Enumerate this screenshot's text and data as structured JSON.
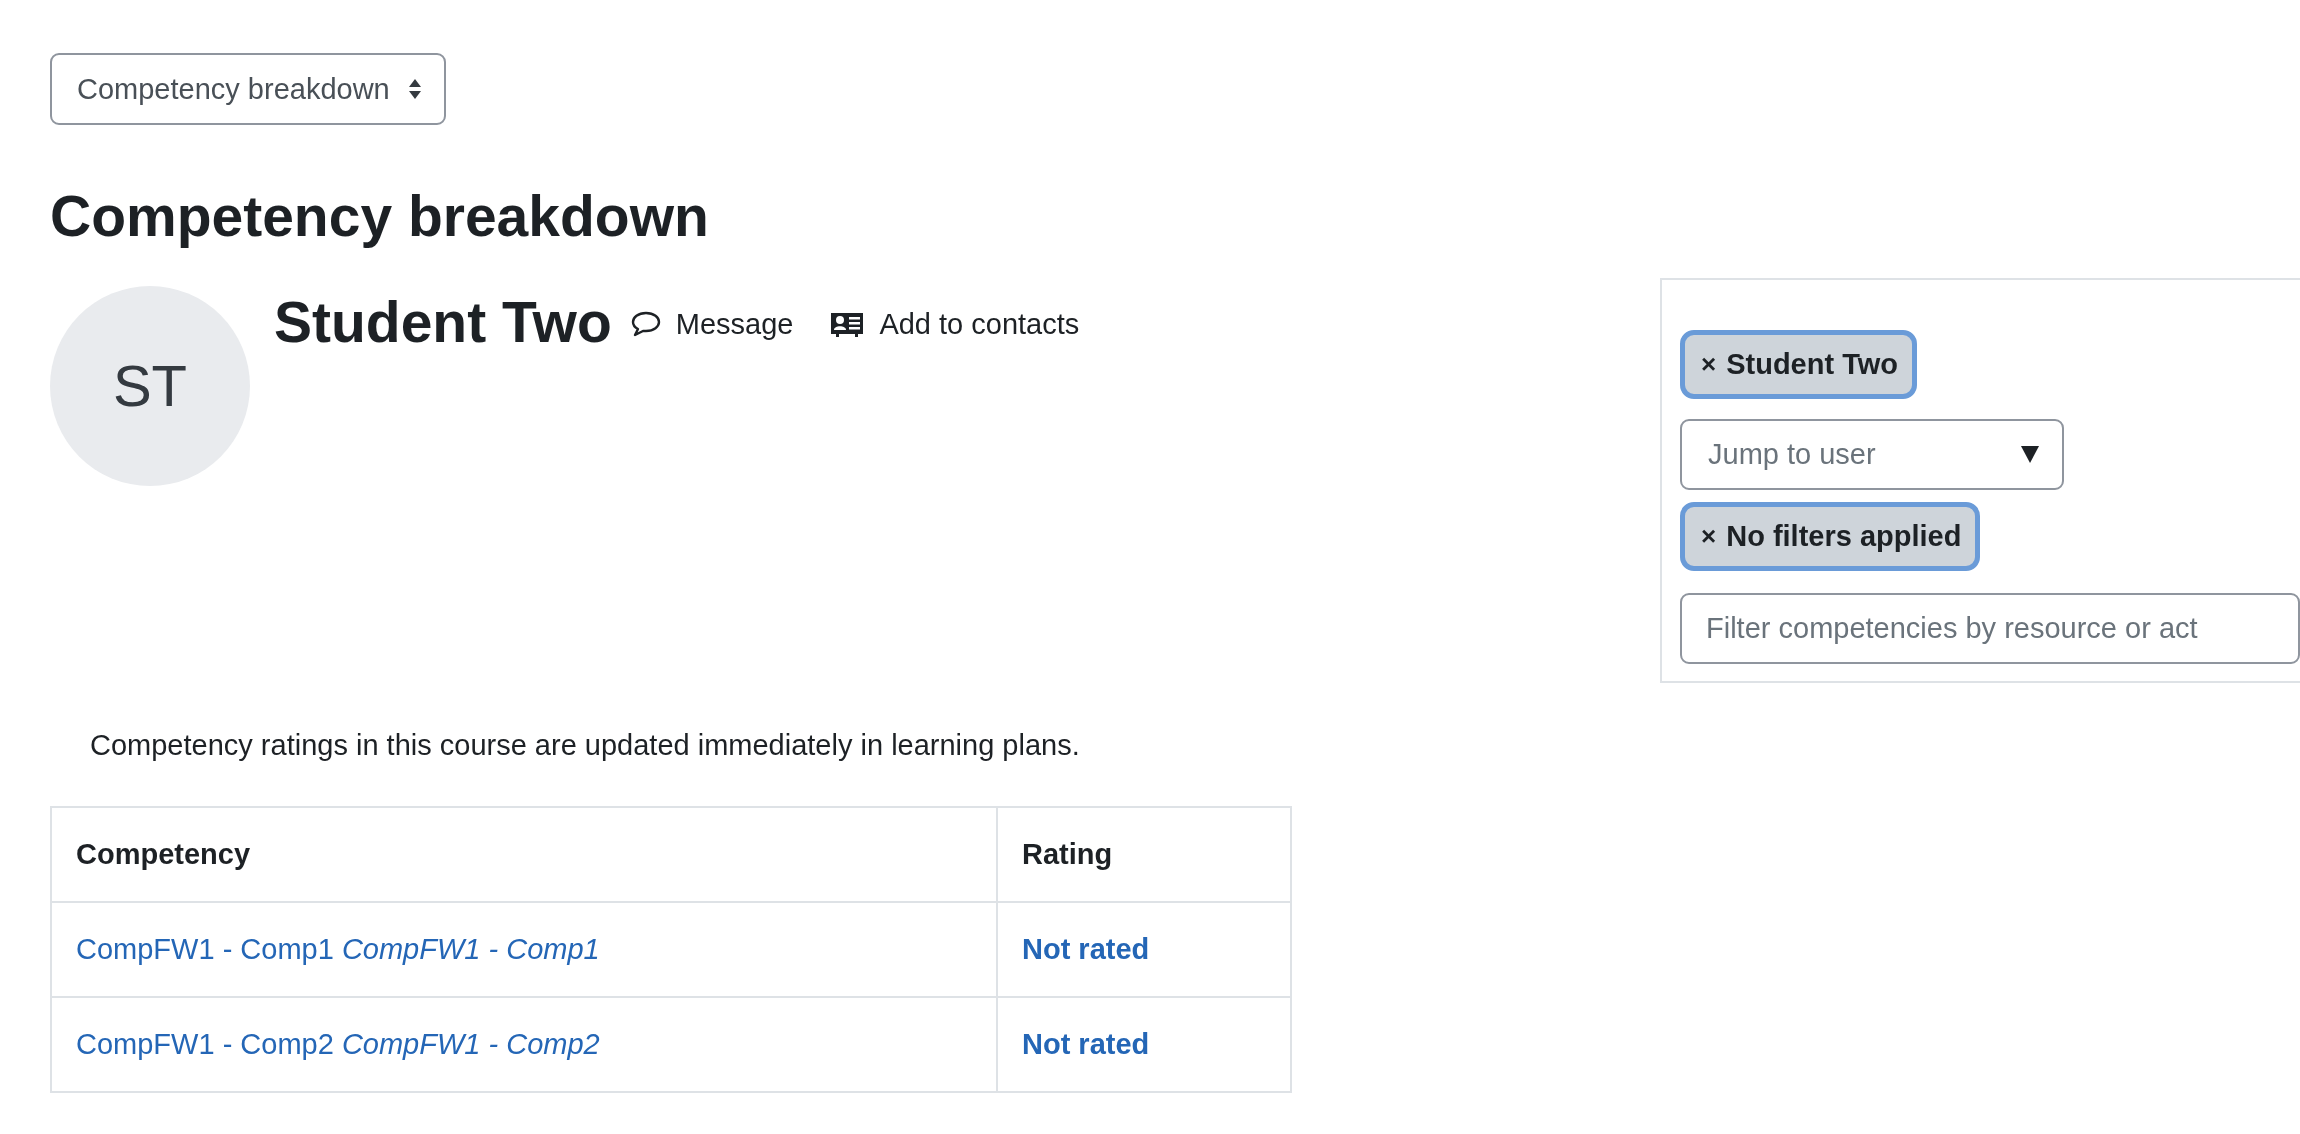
{
  "course_menu": {
    "value": "Competency breakdown"
  },
  "heading": "Competency breakdown",
  "user": {
    "initials": "ST",
    "name": "Student Two",
    "actions": [
      {
        "kind": "message",
        "label": "Message"
      },
      {
        "kind": "contact",
        "label": "Add to contacts"
      }
    ]
  },
  "filters": [
    {
      "kind": "chip",
      "close": "×",
      "label": "Student Two"
    },
    {
      "kind": "select",
      "placeholder": "Jump to user"
    },
    {
      "kind": "chip",
      "close": "×",
      "label": "No filters applied"
    },
    {
      "kind": "input",
      "placeholder": "Filter competencies by resource or act"
    }
  ],
  "notice": "Competency ratings in this course are updated immediately in learning plans.",
  "table": {
    "columns": [
      "Competency",
      "Rating"
    ],
    "rows": [
      {
        "competency": "CompFW1 - Comp1 *CompFW1 - Comp1*",
        "rating": "Not rated"
      },
      {
        "competency": "CompFW1 - Comp2 *CompFW1 - Comp2*",
        "rating": "Not rated"
      }
    ]
  }
}
